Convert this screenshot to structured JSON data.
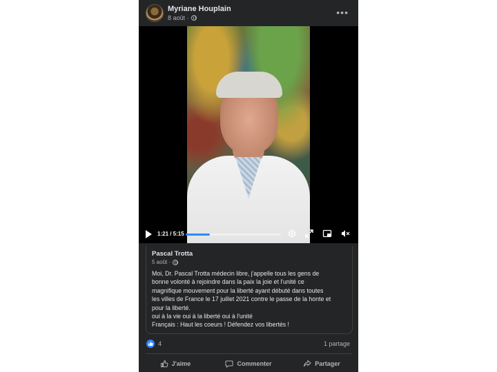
{
  "post": {
    "author": "Myriane Houplain",
    "date": "8 août ·",
    "more_label": "•••"
  },
  "video": {
    "time": "1:21 / 5:15",
    "progress": 0.257
  },
  "shared_post": {
    "author": "Pascal Trotta",
    "date": "5 août ·",
    "text_lines": [
      "Moi, Dr. Pascal Trotta médecin libre,  j'appelle tous les gens de",
      "bonne volonté à rejoindre dans la paix la joie et l'unité ce",
      "magnifique mouvement pour la liberté ayant débuté dans toutes",
      "les villes de France le 17 juillet 2021 contre le passe de la honte et",
      "pour la liberté.",
      "oui à la vie oui à la liberté oui à l'unité",
      "Français :  Haut les coeurs !  Défendez vos libertés !"
    ]
  },
  "engagement": {
    "reaction_count": "4",
    "shares": "1 partage"
  },
  "actions": {
    "like": "J'aime",
    "comment": "Commenter",
    "share": "Partager"
  },
  "colors": {
    "background": "#242526",
    "accent": "#2d88ff",
    "text": "#e4e6eb",
    "secondary": "#b0b3b8"
  }
}
